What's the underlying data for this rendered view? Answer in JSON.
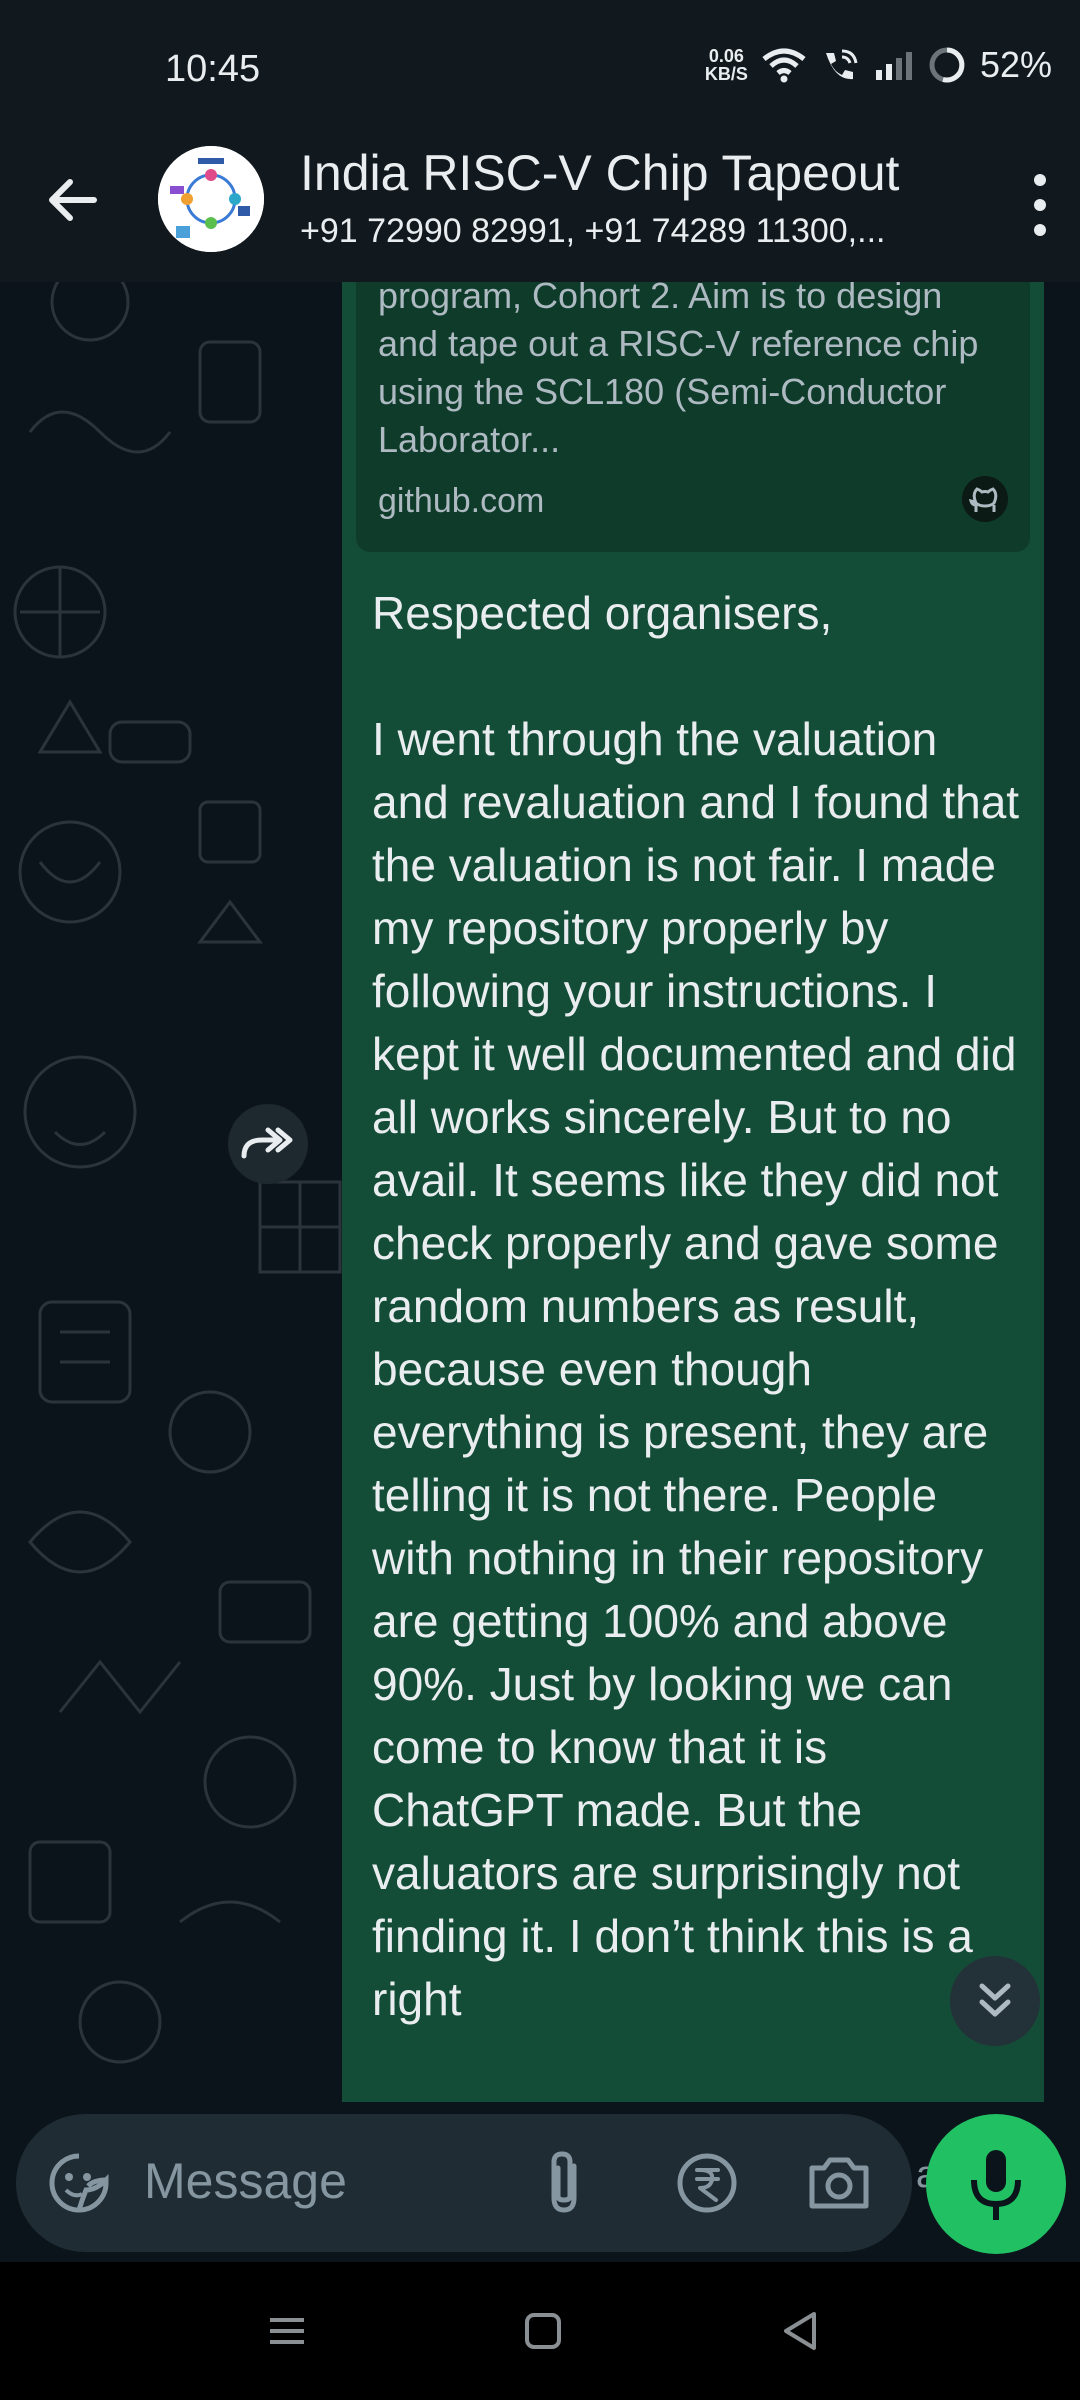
{
  "status_bar": {
    "time": "10:45",
    "net_speed_value": "0.06",
    "net_speed_unit": "KB/S",
    "battery": "52%",
    "icons": [
      "wifi-icon",
      "wifi-calling-icon",
      "signal-icon",
      "battery-icon"
    ]
  },
  "header": {
    "title": "India RISC-V Chip Tapeout",
    "subtitle": "+91 72990 82991, +91 74289 11300,..."
  },
  "link_preview": {
    "description": "program, Cohort 2. Aim is to design and tape out a RISC-V reference chip using the SCL180 (Semi-Conductor Laborator...",
    "domain": "github.com",
    "icon": "github-icon"
  },
  "message": {
    "text": "Respected organisers,\n\nI went through the valuation and revaluation and I found that the valuation is not fair. I made my repository properly by following your instructions. I kept it well documented and did all works sincerely. But to no avail. It seems like they did not check properly and gave some random numbers as result, because even though everything is present, they are telling it is not there. People with nothing in their repository are getting 100% and above 90%. Just by looking we can come to know that it is ChatGPT made. But the valuators are surprisingly not finding it. I don’t think this is a right"
  },
  "input": {
    "placeholder": "Message",
    "partial_text": "a"
  },
  "colors": {
    "bubble": "#144d37",
    "background": "#0b141a",
    "mic_button": "#21c063"
  }
}
